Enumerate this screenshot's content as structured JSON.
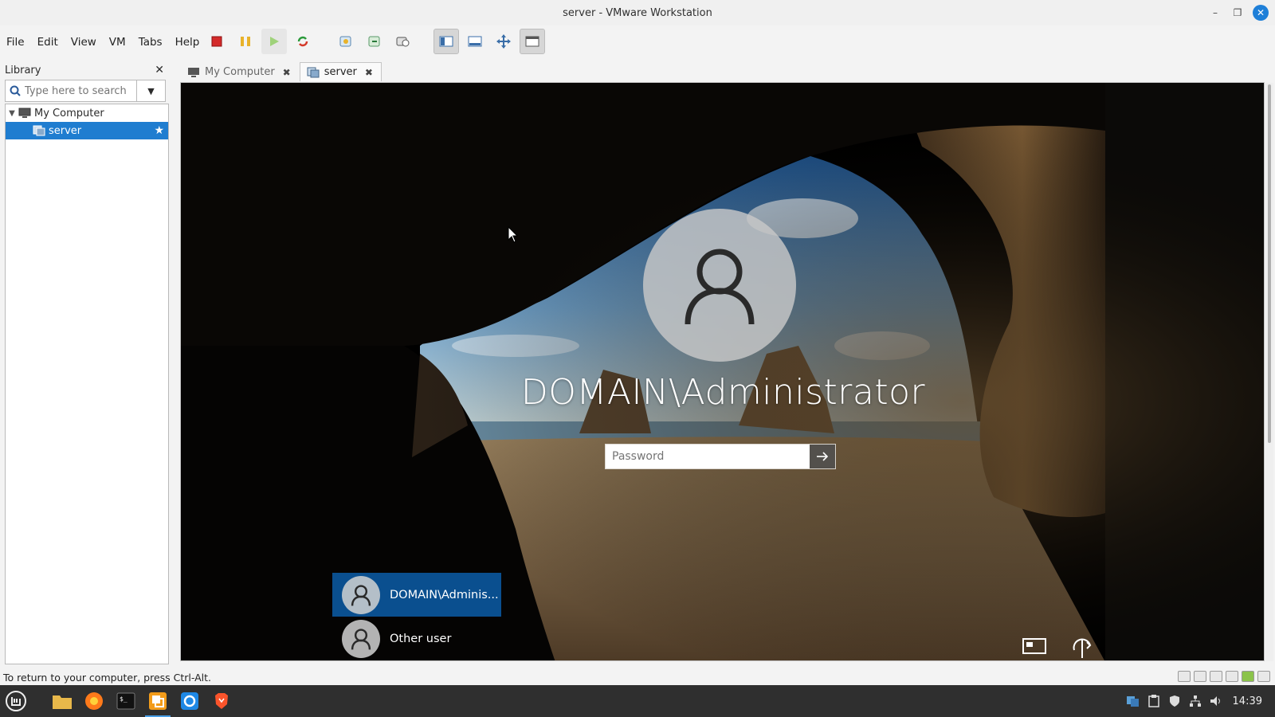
{
  "window": {
    "title": "server - VMware Workstation"
  },
  "menu": [
    "File",
    "Edit",
    "View",
    "VM",
    "Tabs",
    "Help"
  ],
  "library": {
    "title": "Library",
    "search_placeholder": "Type here to search",
    "tree": [
      {
        "label": "My Computer",
        "expanded": true,
        "selected": false
      },
      {
        "label": "server",
        "selected": true,
        "favorite": true
      }
    ]
  },
  "tabs": [
    {
      "label": "My Computer",
      "active": false
    },
    {
      "label": "server",
      "active": true
    }
  ],
  "vm": {
    "login_user": "DOMAIN\\Administrator",
    "password_placeholder": "Password",
    "users": [
      {
        "label": "DOMAIN\\Adminis...",
        "selected": true
      },
      {
        "label": "Other user",
        "selected": false
      }
    ]
  },
  "status": {
    "message": "To return to your computer, press Ctrl-Alt."
  },
  "taskbar": {
    "clock": "14:39"
  },
  "colors": {
    "selection": "#1f7dd0",
    "user_tile_selected": "#0a4f8f",
    "taskbar": "#2f2f2f"
  }
}
